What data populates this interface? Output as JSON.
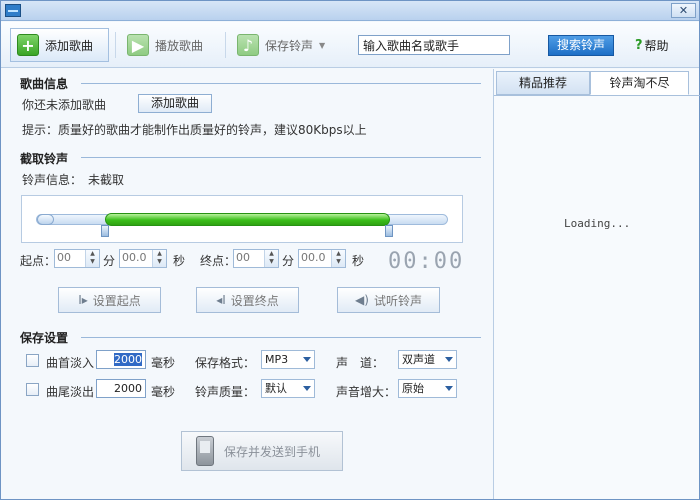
{
  "window": {
    "close_label": "✕"
  },
  "toolbar": {
    "add_song": "添加歌曲",
    "play_song": "播放歌曲",
    "save_ringtone": "保存铃声",
    "search_value": "输入歌曲名或歌手",
    "search_button": "搜索铃声",
    "help": "帮助"
  },
  "song_info": {
    "title": "歌曲信息",
    "status": "你还未添加歌曲",
    "add_button": "添加歌曲",
    "tip": "提示：质量好的歌曲才能制作出质量好的铃声，建议80Kbps以上"
  },
  "clip": {
    "title": "截取铃声",
    "info_label": "铃声信息：",
    "info_value": "未截取",
    "start_label": "起点：",
    "end_label": "终点：",
    "start_min": "00",
    "start_sec": "00.0",
    "end_min": "00",
    "end_sec": "00.0",
    "min_unit": "分",
    "sec_unit": "秒",
    "timer": "00:00",
    "set_start": "设置起点",
    "set_end": "设置终点",
    "preview": "试听铃声"
  },
  "save": {
    "title": "保存设置",
    "fade_in_label": "曲首淡入",
    "fade_in_value": "2000",
    "fade_out_label": "曲尾淡出",
    "fade_out_value": "2000",
    "ms_unit": "毫秒",
    "format_label": "保存格式：",
    "format_value": "MP3",
    "channel_label": "声　道：",
    "channel_value": "双声道",
    "quality_label": "铃声质量：",
    "quality_value": "默认",
    "gain_label": "声音增大：",
    "gain_value": "原始",
    "send_button": "保存并发送到手机"
  },
  "right_panel": {
    "tab_featured": "精品推荐",
    "tab_more": "铃声淘不尽",
    "loading": "Loading..."
  },
  "colors": {
    "accent": "#1e6fc6",
    "green": "#3bbf1b"
  },
  "icons": [
    "app-icon",
    "add-icon",
    "play-icon",
    "music-icon",
    "help-icon",
    "set-start-icon",
    "set-end-icon",
    "speaker-icon",
    "phone-icon"
  ]
}
